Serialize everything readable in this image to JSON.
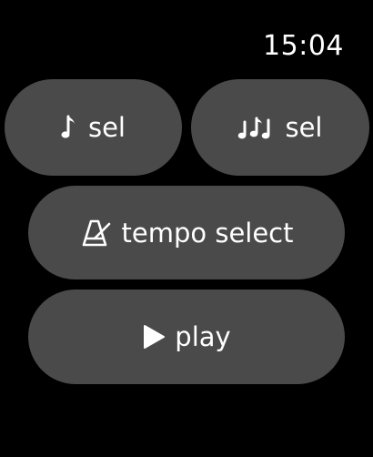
{
  "status_bar": {
    "time": "15:04"
  },
  "buttons": {
    "note_select": {
      "label": "sel",
      "icon": "single-note-icon"
    },
    "notes_select": {
      "label": "sel",
      "icon": "double-notes-icon"
    },
    "tempo_select": {
      "label": "tempo select",
      "icon": "metronome-icon"
    },
    "play": {
      "label": "play",
      "icon": "play-icon"
    }
  },
  "colors": {
    "background": "#000000",
    "button": "#4a4a4a",
    "text": "#ffffff"
  }
}
